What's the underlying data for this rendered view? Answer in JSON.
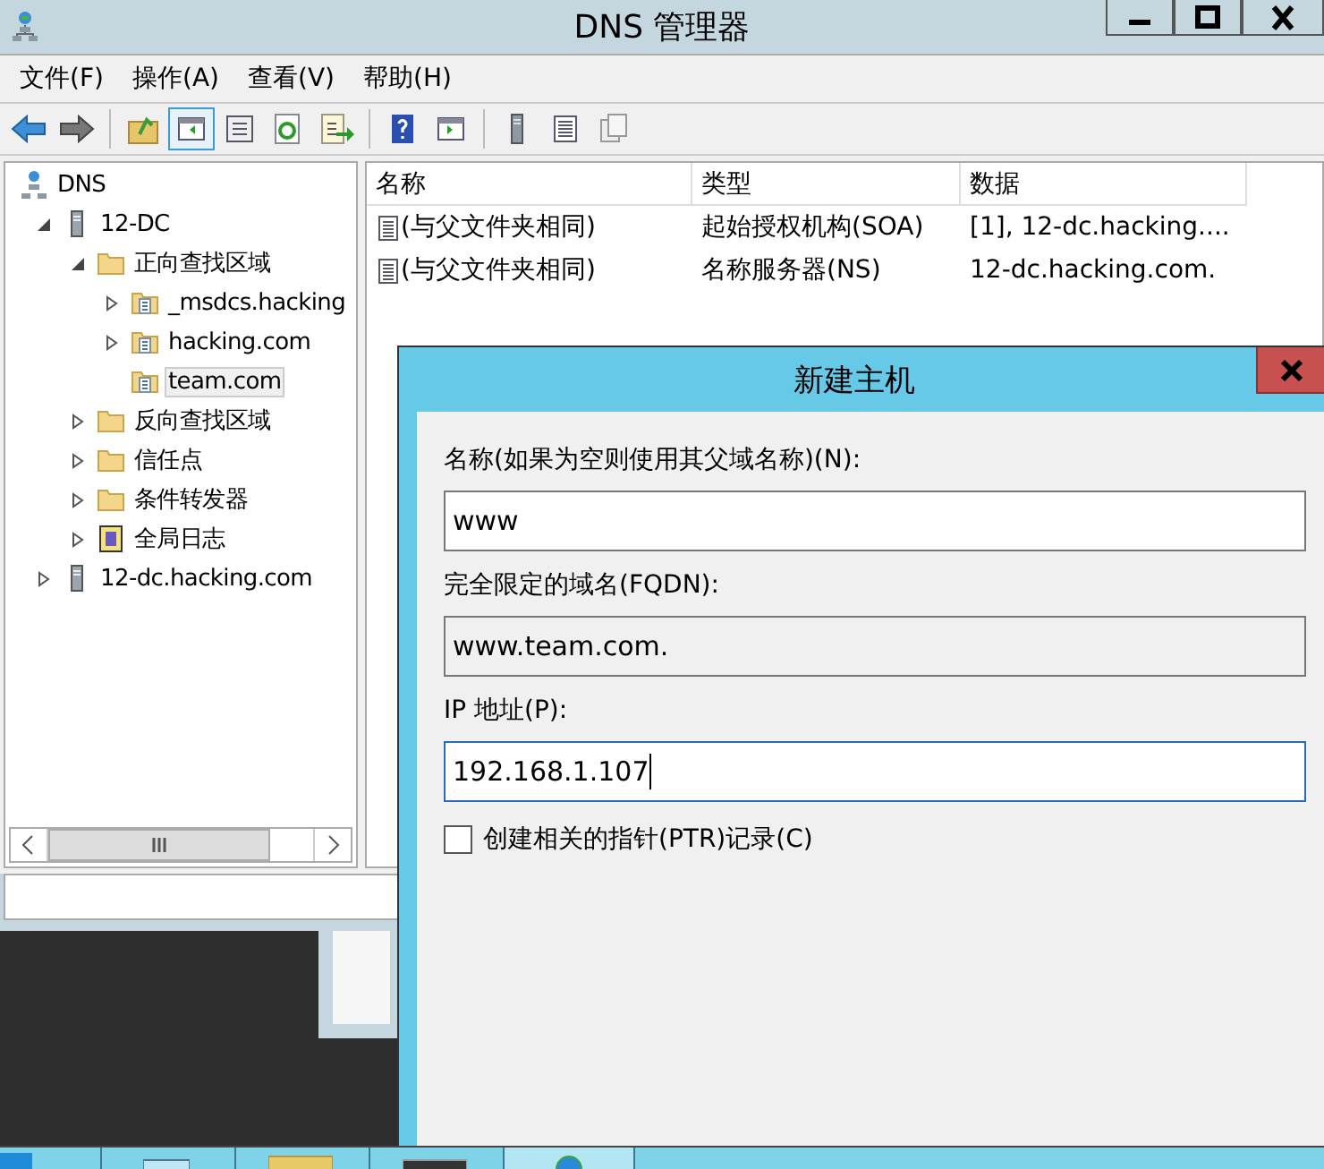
{
  "window": {
    "title": "DNS 管理器"
  },
  "menu": [
    "文件(F)",
    "操作(A)",
    "查看(V)",
    "帮助(H)"
  ],
  "tree": [
    {
      "label": "DNS",
      "kind": "dns",
      "selected": false,
      "children": [
        {
          "label": "12-DC",
          "kind": "server",
          "expanded": true,
          "selected": false,
          "children": [
            {
              "label": "正向查找区域",
              "kind": "folder",
              "expanded": true,
              "selected": false,
              "children": [
                {
                  "label": "_msdcs.hacking",
                  "kind": "zone",
                  "expanded": false,
                  "selected": false
                },
                {
                  "label": "hacking.com",
                  "kind": "zone",
                  "expanded": false,
                  "selected": false
                },
                {
                  "label": "team.com",
                  "kind": "zone",
                  "selected": true
                }
              ]
            },
            {
              "label": "反向查找区域",
              "kind": "folder",
              "expanded": false,
              "selected": false
            },
            {
              "label": "信任点",
              "kind": "folder",
              "expanded": false,
              "selected": false
            },
            {
              "label": "条件转发器",
              "kind": "folder",
              "expanded": false,
              "selected": false
            },
            {
              "label": "全局日志",
              "kind": "log",
              "expanded": false,
              "selected": false
            }
          ]
        },
        {
          "label": "12-dc.hacking.com",
          "kind": "server",
          "expanded": false,
          "selected": false
        }
      ]
    }
  ],
  "list": {
    "columns": [
      "名称",
      "类型",
      "数据"
    ],
    "rows": [
      [
        "(与父文件夹相同)",
        "起始授权机构(SOA)",
        "[1], 12-dc.hacking...."
      ],
      [
        "(与父文件夹相同)",
        "名称服务器(NS)",
        "12-dc.hacking.com."
      ]
    ]
  },
  "dialog": {
    "title": "新建主机",
    "fields": [
      {
        "label": "名称(如果为空则使用其父域名称)(N):",
        "value": "www",
        "kind": "input",
        "focused": false
      },
      {
        "label": "完全限定的域名(FQDN):",
        "value": "www.team.com.",
        "kind": "readonly",
        "focused": false
      },
      {
        "label": "IP 地址(P):",
        "value": "192.168.1.107",
        "kind": "input",
        "focused": true
      }
    ],
    "checkbox": {
      "label": "创建相关的指针(PTR)记录(C)",
      "checked": false
    }
  }
}
